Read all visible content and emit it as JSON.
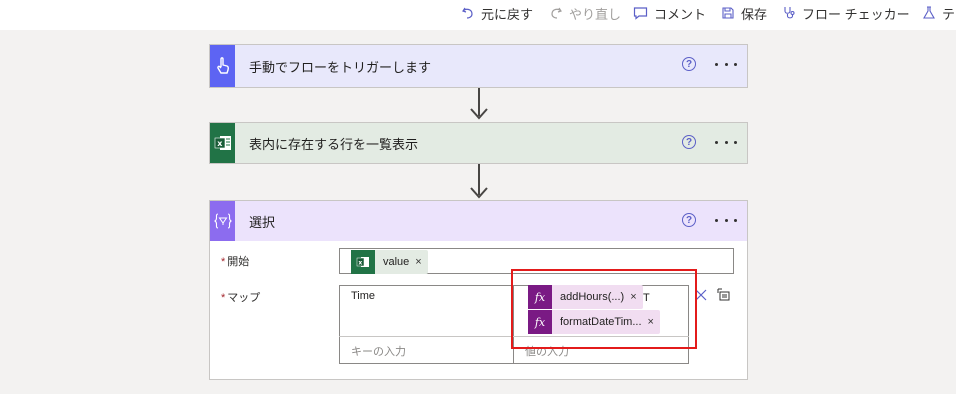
{
  "toolbar": {
    "undo": "元に戻す",
    "redo": "やり直し",
    "comment": "コメント",
    "save": "保存",
    "flow_checker": "フロー チェッカー",
    "test": "テ"
  },
  "steps": {
    "trigger": {
      "title": "手動でフローをトリガーします",
      "color": "#e8e8fb",
      "icon_color": "#5d64f3"
    },
    "excel": {
      "title": "表内に存在する行を一覧表示",
      "color": "#e3ebe3",
      "icon_color": "#217346"
    },
    "select": {
      "title": "選択",
      "color": "#ece3fc",
      "icon_color": "#8c6cef"
    }
  },
  "help_glyph": "?",
  "select_action": {
    "from_label": "開始",
    "map_label": "マップ",
    "required_mark": "*",
    "from_token": {
      "label": "value",
      "close": "×"
    },
    "map_rows": [
      {
        "key": "Time",
        "value_tokens": [
          {
            "label": "addHours(...)",
            "close": "×"
          },
          {
            "label": "formatDateTim...",
            "close": "×"
          }
        ],
        "value_suffix": "T"
      }
    ],
    "key_placeholder": "キーの入力",
    "value_placeholder": "値の入力"
  },
  "colors": {
    "highlight_box": "#e31b1b",
    "fx_token_bg": "#f1ddf1",
    "fx_icon_bg": "#7a1a84",
    "excel_token_bg": "#e3ebe3"
  }
}
